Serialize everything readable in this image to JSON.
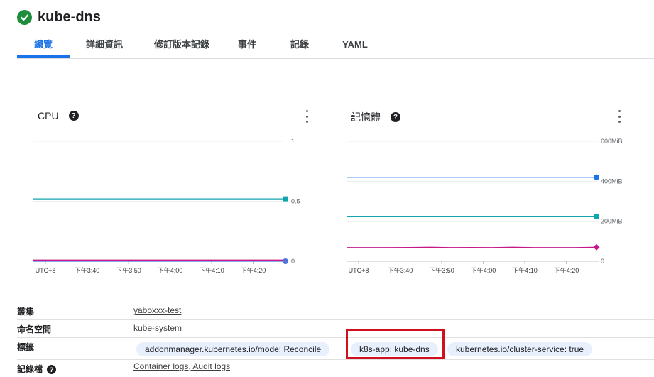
{
  "header": {
    "title": "kube-dns"
  },
  "tabs": [
    {
      "label": "總覽"
    },
    {
      "label": "詳細資訊"
    },
    {
      "label": "修訂版本記錄"
    },
    {
      "label": "事件"
    },
    {
      "label": "記錄"
    },
    {
      "label": "YAML"
    }
  ],
  "colors": {
    "accent": "#1a73e8",
    "ok": "#1e8e3e",
    "teal": "#12a4af",
    "magenta": "#c5198b",
    "highlight": "#d00f1f"
  },
  "chart_data": [
    {
      "type": "line",
      "title": "CPU",
      "x_ticks": [
        "UTC+8",
        "下午3:40",
        "下午3:50",
        "下午4:00",
        "下午4:10",
        "下午4:20"
      ],
      "y_ticks": [
        "1",
        "0.5",
        "0"
      ],
      "ylim": [
        0,
        1
      ],
      "series": [
        {
          "color": "#12a4af",
          "values": [
            0.52,
            0.52,
            0.52,
            0.52,
            0.52,
            0.52,
            0.52
          ]
        },
        {
          "color": "#c5198b",
          "values": [
            0.01,
            0.01,
            0.01,
            0.01,
            0.01,
            0.01,
            0.01
          ]
        },
        {
          "color": "#4e73d9",
          "values": [
            0.0,
            0.0,
            0.0,
            0.0,
            0.0,
            0.0,
            0.0
          ]
        }
      ]
    },
    {
      "type": "line",
      "title": "記憶體",
      "x_ticks": [
        "UTC+8",
        "下午3:40",
        "下午3:50",
        "下午4:00",
        "下午4:10",
        "下午4:20"
      ],
      "y_ticks": [
        "600MiB",
        "400MiB",
        "200MiB",
        "0"
      ],
      "ylim": [
        0,
        600
      ],
      "series": [
        {
          "color": "#1a73e8",
          "values": [
            420,
            420,
            420,
            420,
            420,
            420,
            420
          ]
        },
        {
          "color": "#12a4af",
          "values": [
            225,
            225,
            225,
            225,
            225,
            225,
            225
          ]
        },
        {
          "color": "#c5198b",
          "values": [
            68,
            68,
            68,
            69,
            70,
            68,
            69,
            68,
            70,
            68,
            68,
            68,
            70
          ]
        }
      ]
    }
  ],
  "details": {
    "cluster": {
      "key": "叢集",
      "value": "yaboxxx-test"
    },
    "namespace": {
      "key": "命名空間",
      "value": "kube-system"
    },
    "labels": {
      "key": "標籤",
      "chips": [
        "addonmanager.kubernetes.io/mode: Reconcile",
        "k8s-app: kube-dns",
        "kubernetes.io/cluster-service: true"
      ]
    },
    "logs": {
      "key": "記錄檔",
      "help": "?",
      "links": "Container logs, Audit logs"
    }
  }
}
